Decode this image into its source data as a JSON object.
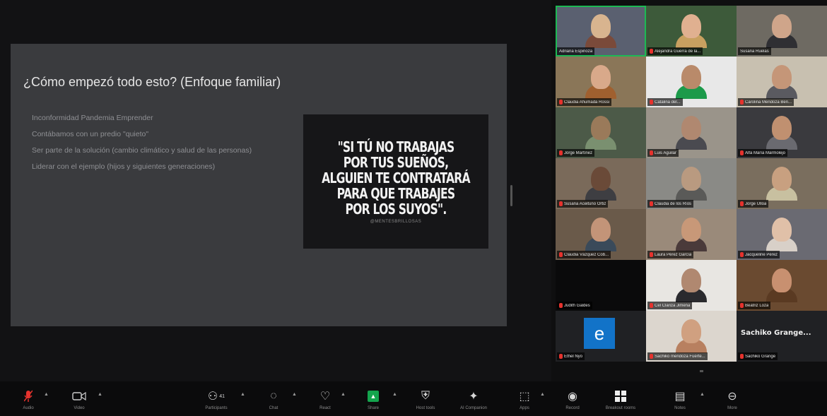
{
  "slide": {
    "title": "¿Cómo empezó todo esto? (Enfoque familiar)",
    "bullets": [
      "Inconformidad Pandemia Emprender",
      "Contábamos con un predio \"quieto\"",
      "Ser parte de la solución (cambio climático y salud de las personas)",
      "Liderar con el ejemplo (hijos y siguientes generaciones)"
    ],
    "quote_lines": [
      "\"SI TÚ NO TRABAJAS",
      "POR TUS SUEÑOS,",
      "ALGUIEN TE CONTRATARÁ",
      "PARA QUE TRABAJES",
      "POR LOS SUYOS\"."
    ],
    "quote_handle": "@MENTESBRILLOSAS"
  },
  "participants": [
    {
      "name": "Adriana Espinoza",
      "muted": false,
      "active": true
    },
    {
      "name": "Alejandra Guerra de la...",
      "muted": true
    },
    {
      "name": "Susana Ruelas",
      "muted": false
    },
    {
      "name": "Claudia Ahumada Rossi",
      "muted": true
    },
    {
      "name": "Catalina del...",
      "muted": true
    },
    {
      "name": "Carolina Mendoza Ben...",
      "muted": true
    },
    {
      "name": "Jorge Martínez",
      "muted": true
    },
    {
      "name": "Luis Aguilar",
      "muted": true
    },
    {
      "name": "Alfa María Marmolejo",
      "muted": true
    },
    {
      "name": "Susana Aceituno Ortiz",
      "muted": true
    },
    {
      "name": "Claudia de los Ríos",
      "muted": true
    },
    {
      "name": "Jorge Ulloa",
      "muted": true
    },
    {
      "name": "Claudia Vázquez Cob...",
      "muted": true
    },
    {
      "name": "Laura Pérez García",
      "muted": true
    },
    {
      "name": "Jacqueline Pérez",
      "muted": true
    },
    {
      "name": "Judith Galdes",
      "muted": true
    },
    {
      "name": "Cel Clariza Jimena",
      "muted": true
    },
    {
      "name": "Beatriz Loza",
      "muted": true
    },
    {
      "name": "Ethel Nyo",
      "muted": true,
      "avatar_letter": "e"
    },
    {
      "name": "Sachiko mendoza Fuerte...",
      "muted": true
    },
    {
      "name": "Sachiko Grange",
      "muted": true,
      "big_name": "Sachiko Grange..."
    }
  ],
  "toolbar": {
    "audio": "Audio",
    "video": "Video",
    "participants": "Participants",
    "participants_count": "41",
    "chat": "Chat",
    "react": "React",
    "share": "Share",
    "host_tools": "Host tools",
    "ai_companion": "AI Companion",
    "apps": "Apps",
    "record": "Record",
    "breakout_rooms": "Breakout rooms",
    "notes": "Notes",
    "more": "More"
  }
}
